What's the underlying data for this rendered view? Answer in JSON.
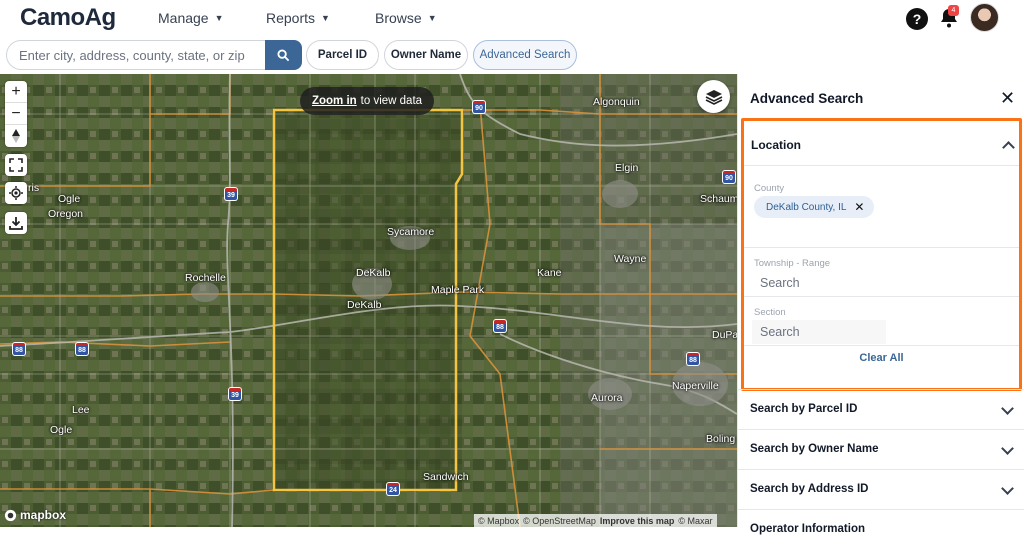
{
  "brand": {
    "name": "CamoAg"
  },
  "nav": {
    "items": [
      {
        "label": "Manage"
      },
      {
        "label": "Reports"
      },
      {
        "label": "Browse"
      }
    ],
    "help_label": "?",
    "notification_count": "4"
  },
  "search": {
    "placeholder": "Enter city, address, county, state, or zip",
    "pills": [
      {
        "label": "Parcel ID"
      },
      {
        "label": "Owner Name"
      },
      {
        "label": "Advanced Search"
      }
    ]
  },
  "map": {
    "zoom_hint_link": "Zoom in",
    "zoom_hint_text": "to view data",
    "attribution": {
      "mapbox": "© Mapbox",
      "osm": "© OpenStreetMap",
      "improve": "Improve this map",
      "maxar": "© Maxar"
    },
    "logo_text": "mapbox",
    "places": [
      {
        "name": "Algonquin"
      },
      {
        "name": "Elgin"
      },
      {
        "name": "Schaum"
      },
      {
        "name": "Ogle"
      },
      {
        "name": "Oregon"
      },
      {
        "name": "ris"
      },
      {
        "name": "Sycamore"
      },
      {
        "name": "DeKalb"
      },
      {
        "name": "DeKalb"
      },
      {
        "name": "Maple Park"
      },
      {
        "name": "Kane"
      },
      {
        "name": "Wayne"
      },
      {
        "name": "Rochelle"
      },
      {
        "name": "DuPa"
      },
      {
        "name": "Naperville"
      },
      {
        "name": "Aurora"
      },
      {
        "name": "Lee"
      },
      {
        "name": "Ogle"
      },
      {
        "name": "Boling"
      },
      {
        "name": "Sandwich"
      }
    ],
    "shields": [
      "90",
      "90",
      "39",
      "88",
      "88",
      "88",
      "39",
      "88",
      "88",
      "24"
    ]
  },
  "panel": {
    "title": "Advanced Search",
    "location": {
      "header": "Location",
      "county_label": "County",
      "county_value": "DeKalb County, IL",
      "township_label": "Township - Range",
      "township_placeholder": "Search",
      "section_label": "Section",
      "section_placeholder": "Search",
      "clear_all": "Clear All"
    },
    "sections": [
      {
        "label": "Search by Parcel ID"
      },
      {
        "label": "Search by Owner Name"
      },
      {
        "label": "Search by Address ID"
      },
      {
        "label": "Operator Information"
      }
    ]
  },
  "colors": {
    "accent": "#3b6695",
    "highlight_border": "#f97316",
    "county_boundary": "#f5c542"
  }
}
